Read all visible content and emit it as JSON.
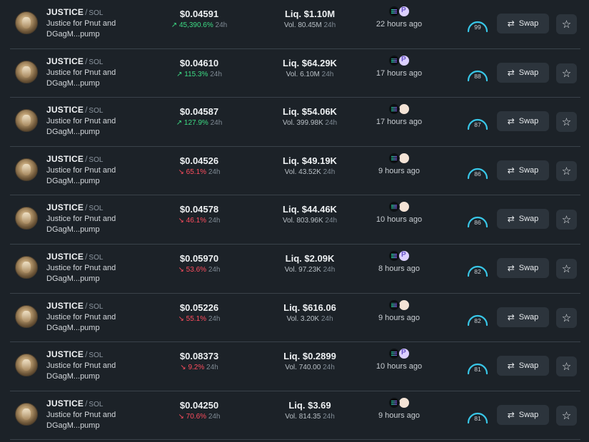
{
  "token": {
    "symbol": "JUSTICE",
    "chain": "SOL",
    "description": "Justice for Pnut and DGagM...pump"
  },
  "labels": {
    "liq_prefix": "Liq.",
    "vol_prefix": "Vol.",
    "period": "24h",
    "swap": "Swap"
  },
  "icons": {
    "swap": "swap-arrows-icon",
    "star": "star-icon",
    "chain_badge": "solana-icon"
  },
  "colors": {
    "up": "#3ddc84",
    "down": "#ff4d5e",
    "gauge": "#38c7e8"
  },
  "rows": [
    {
      "price": "$0.04591",
      "direction": "up",
      "change": "45,390.6%",
      "liq": "$1.10M",
      "vol": "80.45M",
      "age": "22 hours ago",
      "badge": "pump",
      "score": "99"
    },
    {
      "price": "$0.04610",
      "direction": "up",
      "change": "115.3%",
      "liq": "$64.29K",
      "vol": "6.10M",
      "age": "17 hours ago",
      "badge": "pump",
      "score": "88"
    },
    {
      "price": "$0.04587",
      "direction": "up",
      "change": "127.9%",
      "liq": "$54.06K",
      "vol": "399.98K",
      "age": "17 hours ago",
      "badge": "light",
      "score": "87"
    },
    {
      "price": "$0.04526",
      "direction": "down",
      "change": "65.1%",
      "liq": "$49.19K",
      "vol": "43.52K",
      "age": "9 hours ago",
      "badge": "light",
      "score": "86"
    },
    {
      "price": "$0.04578",
      "direction": "down",
      "change": "46.1%",
      "liq": "$44.46K",
      "vol": "803.96K",
      "age": "10 hours ago",
      "badge": "light",
      "score": "86"
    },
    {
      "price": "$0.05970",
      "direction": "down",
      "change": "53.6%",
      "liq": "$2.09K",
      "vol": "97.23K",
      "age": "8 hours ago",
      "badge": "pump",
      "score": "82"
    },
    {
      "price": "$0.05226",
      "direction": "down",
      "change": "55.1%",
      "liq": "$616.06",
      "vol": "3.20K",
      "age": "9 hours ago",
      "badge": "light",
      "score": "82"
    },
    {
      "price": "$0.08373",
      "direction": "down",
      "change": "9.2%",
      "liq": "$0.2899",
      "vol": "740.00",
      "age": "10 hours ago",
      "badge": "pump",
      "score": "81"
    },
    {
      "price": "$0.04250",
      "direction": "down",
      "change": "70.6%",
      "liq": "$3.69",
      "vol": "814.35",
      "age": "9 hours ago",
      "badge": "light",
      "score": "81"
    }
  ]
}
